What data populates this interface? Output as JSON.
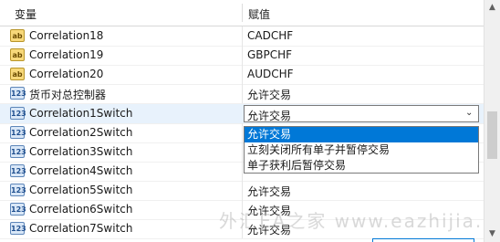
{
  "header": {
    "col_variable": "变量",
    "col_value": "赋值"
  },
  "rows": [
    {
      "icon": "ab",
      "name": "Correlation18",
      "value": "CADCHF"
    },
    {
      "icon": "ab",
      "name": "Correlation19",
      "value": "GBPCHF"
    },
    {
      "icon": "ab",
      "name": "Correlation20",
      "value": "AUDCHF"
    },
    {
      "icon": "123",
      "name": "货币对总控制器",
      "value": "允许交易"
    },
    {
      "icon": "123",
      "name": "Correlation1Switch",
      "value": "允许交易"
    },
    {
      "icon": "123",
      "name": "Correlation2Switch",
      "value": ""
    },
    {
      "icon": "123",
      "name": "Correlation3Switch",
      "value": ""
    },
    {
      "icon": "123",
      "name": "Correlation4Switch",
      "value": ""
    },
    {
      "icon": "123",
      "name": "Correlation5Switch",
      "value": "允许交易"
    },
    {
      "icon": "123",
      "name": "Correlation6Switch",
      "value": "允许交易"
    },
    {
      "icon": "123",
      "name": "Correlation7Switch",
      "value": "允许交易"
    }
  ],
  "dropdown": {
    "options": [
      "允许交易",
      "立刻关闭所有单子并暂停交易",
      "单子获利后暂停交易"
    ],
    "selected": "允许交易"
  },
  "watermark": "外汇EA之家 www.eazhijia.com",
  "scrollbar": {
    "up_arrow": "▲",
    "down_arrow": "▼"
  }
}
